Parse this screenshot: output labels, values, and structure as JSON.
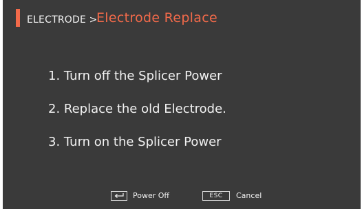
{
  "header": {
    "breadcrumb": "ELECTRODE >",
    "title": "Electrode Replace"
  },
  "steps": [
    "1. Turn off the Splicer Power",
    "2. Replace the old Electrode.",
    "3. Turn on the Splicer Power"
  ],
  "footer": {
    "enter_key_icon": "enter-return-arrow",
    "power_off_label": "Power Off",
    "esc_key_label": "ESC",
    "cancel_label": "Cancel"
  },
  "colors": {
    "background": "#3a3a3a",
    "accent": "#f26a4a",
    "text": "#f2f2f2"
  }
}
